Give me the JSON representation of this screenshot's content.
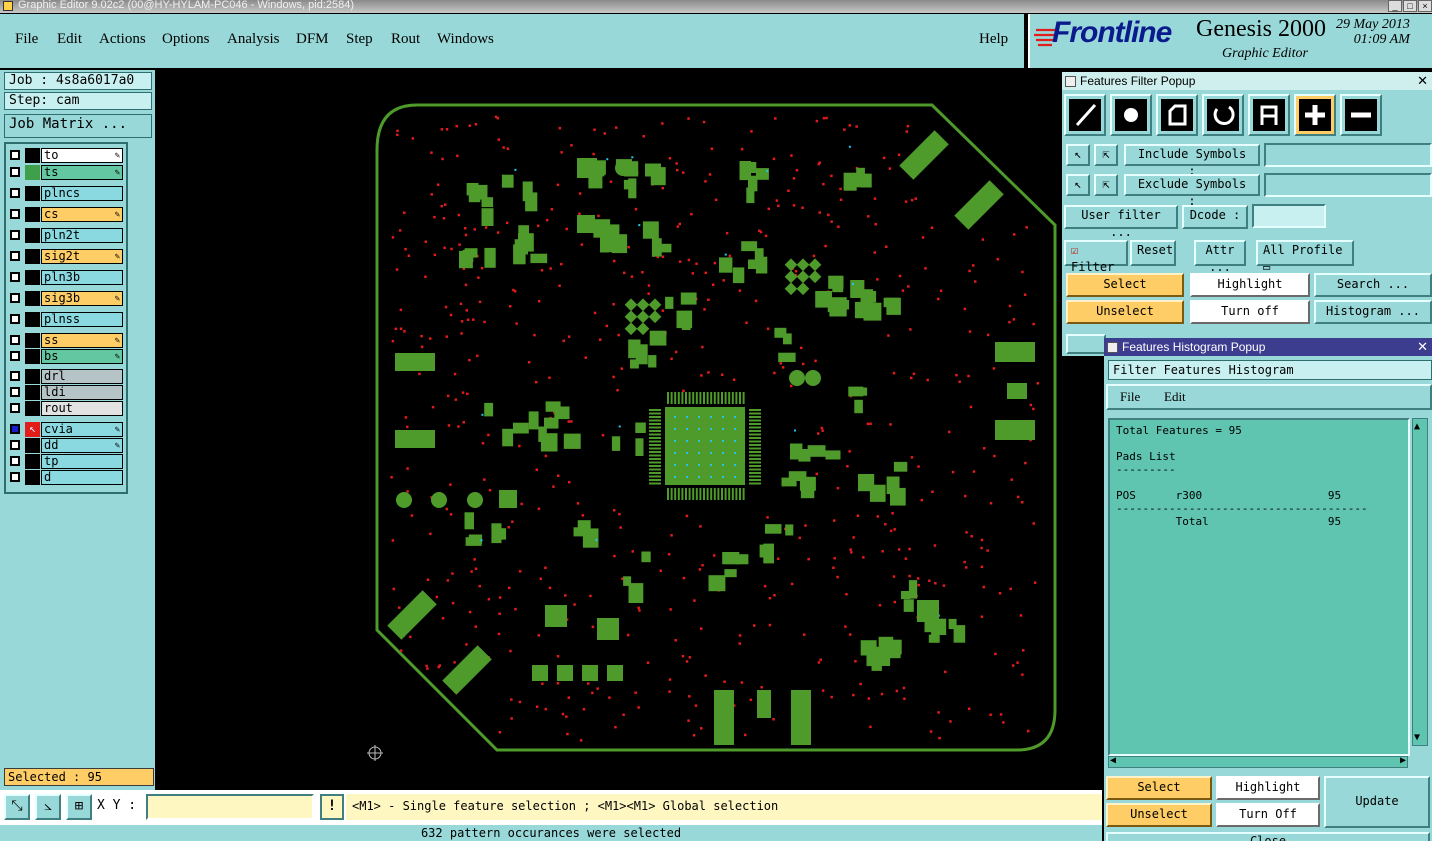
{
  "window": {
    "title": "Graphic Editor 9.02c2 (00@HY-HYLAM-PC046 - Windows, pid:2584)"
  },
  "menubar": {
    "items": [
      "File",
      "Edit",
      "Actions",
      "Options",
      "Analysis",
      "DFM",
      "Step",
      "Rout",
      "Windows"
    ],
    "help": "Help"
  },
  "brand": {
    "logo": "Frontline",
    "product": "Genesis 2000",
    "subtitle": "Graphic Editor",
    "date": "29 May 2013",
    "time": "01:09 AM"
  },
  "job": {
    "job_label": "Job : 4s8a6017a0",
    "step_label": "Step: cam",
    "matrix_button": "Job Matrix ..."
  },
  "layers": [
    {
      "name": "to",
      "color": "#ffffff",
      "swatch": "#000000",
      "editable": true
    },
    {
      "name": "ts",
      "color": "#63c7a2",
      "swatch": "#3ea04a",
      "editable": true
    },
    {
      "name": "plncs",
      "color": "#8ad8e0",
      "swatch": "#000000",
      "editable": false
    },
    {
      "name": "cs",
      "color": "#ffcd66",
      "swatch": "#000000",
      "editable": true
    },
    {
      "name": "pln2t",
      "color": "#8ad8e0",
      "swatch": "#000000",
      "editable": false
    },
    {
      "name": "sig2t",
      "color": "#ffcd66",
      "swatch": "#000000",
      "editable": true
    },
    {
      "name": "pln3b",
      "color": "#8ad8e0",
      "swatch": "#000000",
      "editable": false
    },
    {
      "name": "sig3b",
      "color": "#ffcd66",
      "swatch": "#000000",
      "editable": true
    },
    {
      "name": "plnss",
      "color": "#8ad8e0",
      "swatch": "#000000",
      "editable": false
    },
    {
      "name": "ss",
      "color": "#ffcd66",
      "swatch": "#000000",
      "editable": true
    },
    {
      "name": "bs",
      "color": "#63c7a2",
      "swatch": "#000000",
      "editable": true
    },
    {
      "name": "drl",
      "color": "#b6c4c8",
      "swatch": "#000000",
      "editable": false
    },
    {
      "name": "ldi",
      "color": "#b6c4c8",
      "swatch": "#000000",
      "editable": false
    },
    {
      "name": "rout",
      "color": "#e2e2e2",
      "swatch": "#000000",
      "editable": false
    },
    {
      "name": "cvia",
      "color": "#8ad8e0",
      "swatch": "#e21b1b",
      "editable": true
    },
    {
      "name": "dd",
      "color": "#8ad8e0",
      "swatch": "#000000",
      "editable": true
    },
    {
      "name": "tp",
      "color": "#8ad8e0",
      "swatch": "#000000",
      "editable": false
    },
    {
      "name": "d",
      "color": "#8ad8e0",
      "swatch": "#000000",
      "editable": false
    }
  ],
  "selected": "Selected : 95",
  "bottom": {
    "xy_label": "X Y :",
    "xy_value": "",
    "warn": "!",
    "hint": "<M1> - Single feature selection ; <M1><M1> Global selection",
    "status": "632 pattern occurances were selected"
  },
  "filter_popup": {
    "title": "Features Filter Popup",
    "include_label": "Include Symbols :",
    "exclude_label": "Exclude Symbols :",
    "user_filter": "User filter ...",
    "dcode_label": "Dcode :",
    "filter_label": "Filter",
    "reset": "Reset",
    "attr": "Attr ...",
    "profile": "All Profile",
    "select": "Select",
    "highlight": "Highlight",
    "search": "Search ...",
    "unselect": "Unselect",
    "turn_off": "Turn off",
    "histogram": "Histogram ..."
  },
  "histogram_popup": {
    "title": "Features Histogram Popup",
    "subtitle": "Filter Features Histogram",
    "menu_file": "File",
    "menu_edit": "Edit",
    "text": "Total Features = 95\n\nPads List\n---------\n\nPOS      r300                   95\n--------------------------------------\n         Total                  95",
    "select": "Select",
    "highlight": "Highlight",
    "update": "Update",
    "unselect": "Unselect",
    "turn_off": "Turn Off",
    "close": "Close"
  },
  "colors": {
    "panel": "#99d8d8",
    "board_outline": "#4e9a2a",
    "pad": "#4e9a2a",
    "via": "#e21b1b",
    "selected": "#22c8e8"
  }
}
